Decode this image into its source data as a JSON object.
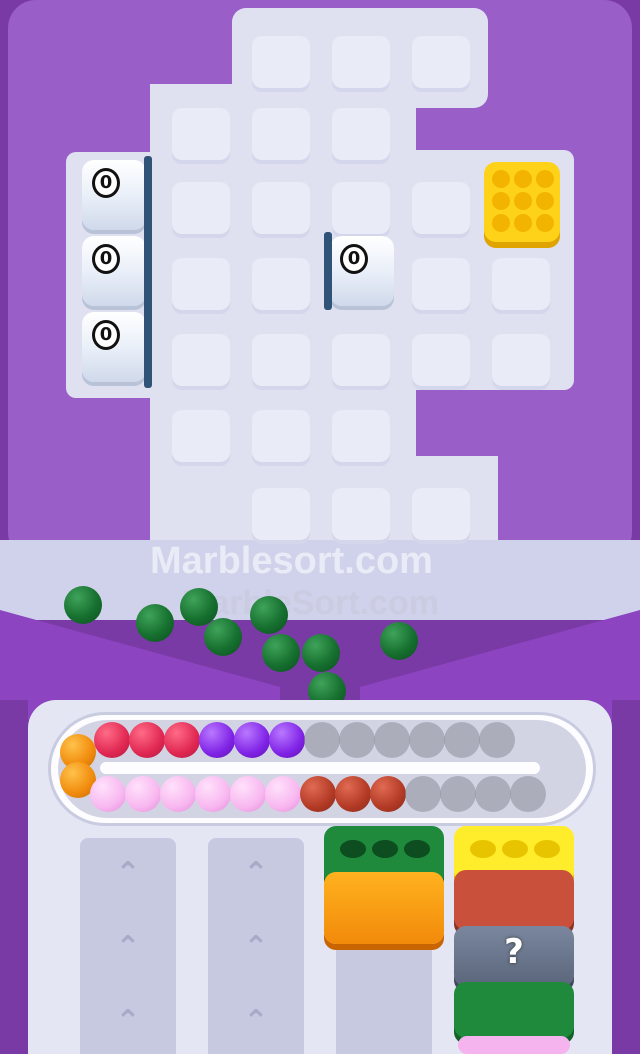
{
  "game": {
    "watermark_primary": "Marblesort.com",
    "watermark_secondary": "MarbleSort.com",
    "ice_blocks": [
      {
        "count": "0"
      },
      {
        "count": "0"
      },
      {
        "count": "0"
      },
      {
        "count": "0"
      }
    ],
    "mystery_box_label": "?"
  },
  "colors": {
    "board_frame": "#9a5ec8",
    "board_floor": "#dfe1f1",
    "background": "#7a3aa6",
    "marble_green": "#16702f",
    "crate_yellow": "#ffd21a"
  },
  "track": {
    "top_row": [
      "orange",
      "red",
      "red",
      "red",
      "purple",
      "purple",
      "purple",
      "empty",
      "empty",
      "empty",
      "empty",
      "empty",
      "empty"
    ],
    "bottom_row": [
      "orange",
      "pink",
      "pink",
      "pink",
      "pink",
      "pink",
      "pink",
      "brown",
      "brown",
      "brown",
      "empty",
      "empty",
      "empty",
      "empty"
    ]
  },
  "collector_columns": [
    {
      "stack": [
        "green-open",
        "orange"
      ]
    },
    {
      "stack": [
        "yellow-open",
        "red",
        "mystery",
        "green",
        "pink"
      ]
    }
  ]
}
